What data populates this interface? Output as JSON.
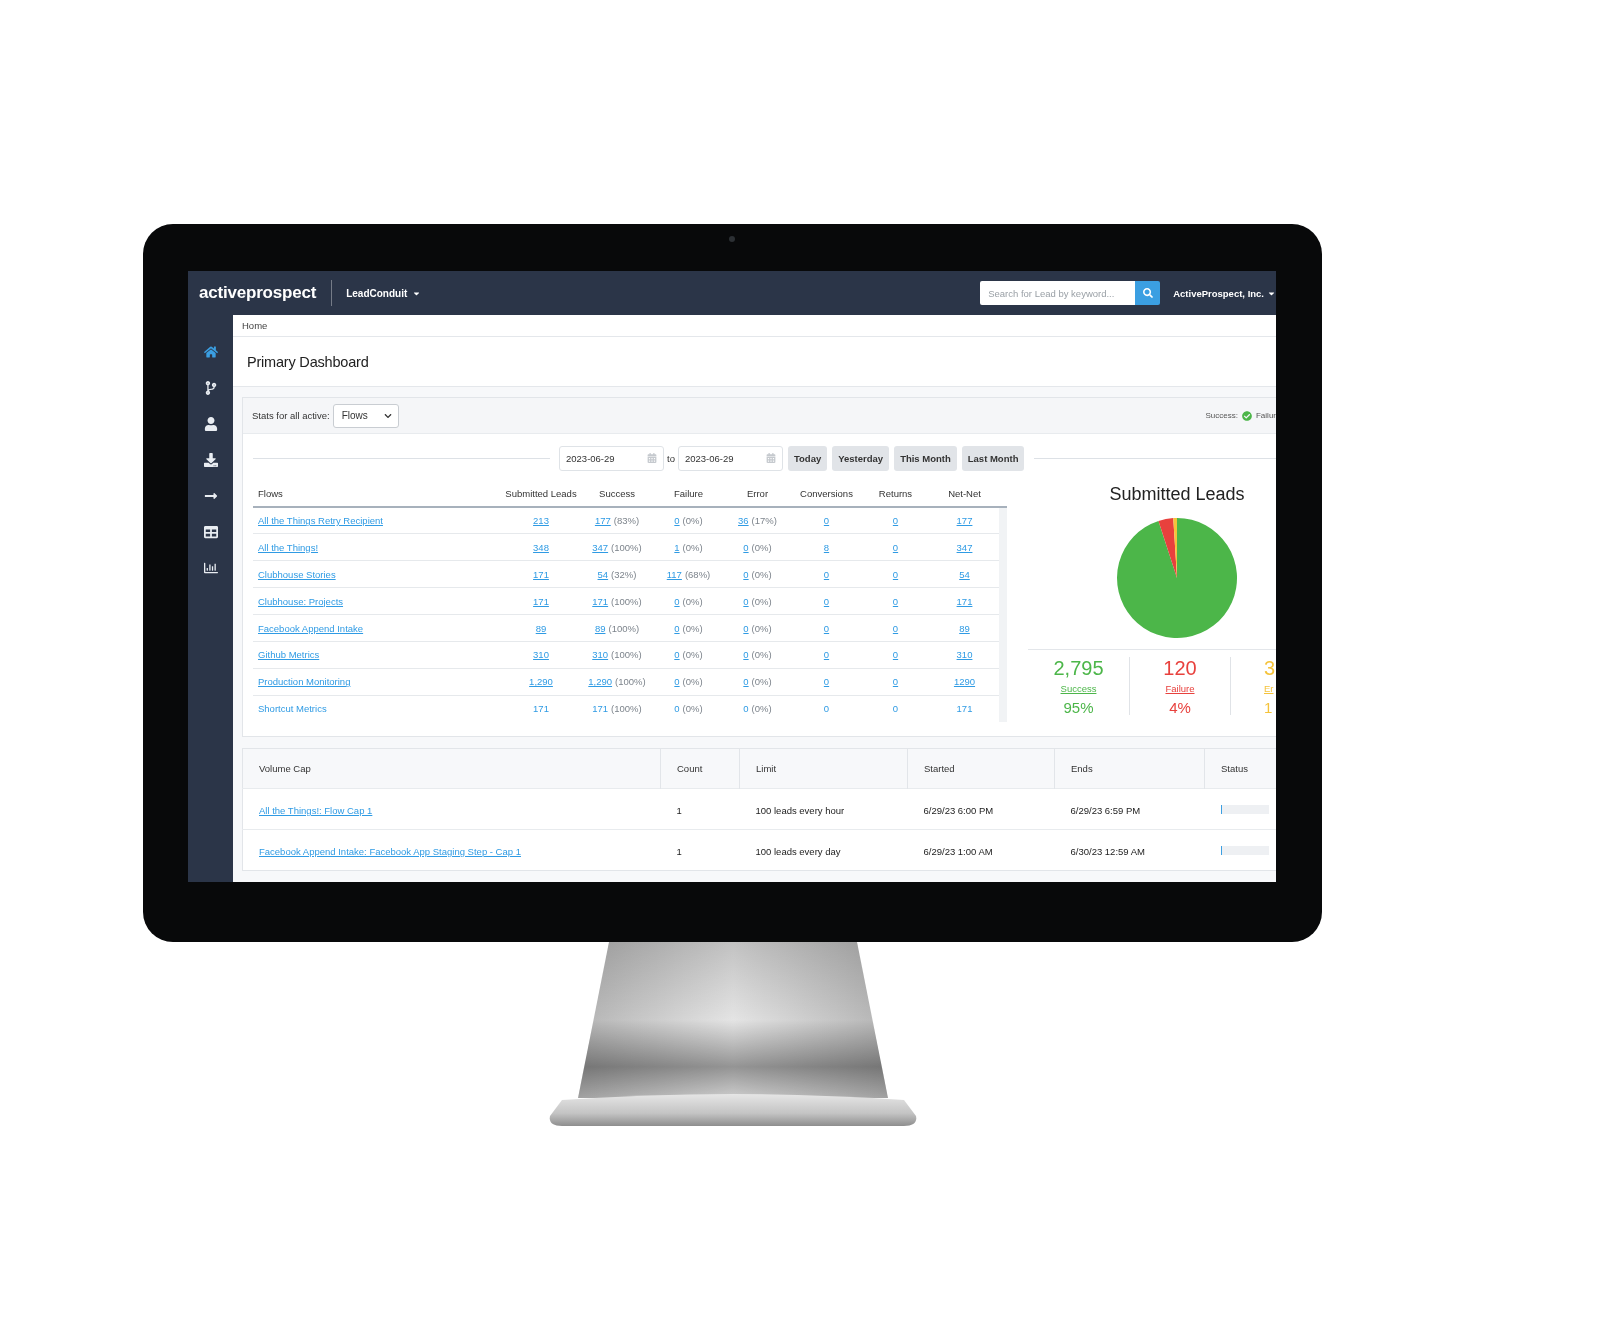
{
  "navbar": {
    "logo": "activeprospect",
    "product_menu": "LeadConduit",
    "search": {
      "placeholder": "Search for Lead by keyword..."
    },
    "account_menu": "ActiveProspect, Inc."
  },
  "sidebar": {
    "items": [
      {
        "kind": "home",
        "selected": true
      },
      {
        "kind": "flow",
        "selected": false
      },
      {
        "kind": "user",
        "selected": false
      },
      {
        "kind": "download",
        "selected": false
      },
      {
        "kind": "arrow",
        "selected": false
      },
      {
        "kind": "table",
        "selected": false
      },
      {
        "kind": "chart",
        "selected": false
      }
    ]
  },
  "breadcrumb": [
    "Home"
  ],
  "page_title": "Primary Dashboard",
  "stats_panel": {
    "filter_label": "Stats for all active:",
    "filter_select": "Flows",
    "legend": {
      "success_label": "Success:",
      "failure_label": "Failur"
    },
    "date_range": {
      "from": "2023-06-29",
      "separator": "to",
      "to": "2023-06-29"
    },
    "presets": [
      "Today",
      "Yesterday",
      "This Month",
      "Last Month"
    ],
    "flows_table": {
      "columns": [
        "Flows",
        "Submitted Leads",
        "Success",
        "Failure",
        "Error",
        "Conversions",
        "Returns",
        "Net-Net"
      ],
      "rows": [
        {
          "linked": true,
          "flow": "All the Things Retry Recipient",
          "submitted": "213",
          "success": {
            "value": "177",
            "percent": "(83%)"
          },
          "failure": {
            "value": "0",
            "percent": "(0%)"
          },
          "error": {
            "value": "36",
            "percent": "(17%)"
          },
          "conversions": "0",
          "returns": "0",
          "net_net": "177"
        },
        {
          "linked": true,
          "flow": "All the Things!",
          "submitted": "348",
          "success": {
            "value": "347",
            "percent": "(100%)"
          },
          "failure": {
            "value": "1",
            "percent": "(0%)"
          },
          "error": {
            "value": "0",
            "percent": "(0%)"
          },
          "conversions": "8",
          "returns": "0",
          "net_net": "347"
        },
        {
          "linked": true,
          "flow": "Clubhouse Stories",
          "submitted": "171",
          "success": {
            "value": "54",
            "percent": "(32%)"
          },
          "failure": {
            "value": "117",
            "percent": "(68%)"
          },
          "error": {
            "value": "0",
            "percent": "(0%)"
          },
          "conversions": "0",
          "returns": "0",
          "net_net": "54"
        },
        {
          "linked": true,
          "flow": "Clubhouse: Projects",
          "submitted": "171",
          "success": {
            "value": "171",
            "percent": "(100%)"
          },
          "failure": {
            "value": "0",
            "percent": "(0%)"
          },
          "error": {
            "value": "0",
            "percent": "(0%)"
          },
          "conversions": "0",
          "returns": "0",
          "net_net": "171"
        },
        {
          "linked": true,
          "flow": "Facebook Append Intake",
          "submitted": "89",
          "success": {
            "value": "89",
            "percent": "(100%)"
          },
          "failure": {
            "value": "0",
            "percent": "(0%)"
          },
          "error": {
            "value": "0",
            "percent": "(0%)"
          },
          "conversions": "0",
          "returns": "0",
          "net_net": "89"
        },
        {
          "linked": true,
          "flow": "Github Metrics",
          "submitted": "310",
          "success": {
            "value": "310",
            "percent": "(100%)"
          },
          "failure": {
            "value": "0",
            "percent": "(0%)"
          },
          "error": {
            "value": "0",
            "percent": "(0%)"
          },
          "conversions": "0",
          "returns": "0",
          "net_net": "310"
        },
        {
          "linked": true,
          "flow": "Production Monitoring",
          "submitted": "1,290",
          "success": {
            "value": "1,290",
            "percent": "(100%)"
          },
          "failure": {
            "value": "0",
            "percent": "(0%)"
          },
          "error": {
            "value": "0",
            "percent": "(0%)"
          },
          "conversions": "0",
          "returns": "0",
          "net_net": "1290"
        },
        {
          "linked": false,
          "flow": "Shortcut Metrics",
          "submitted": "171",
          "success": {
            "value": "171",
            "percent": "(100%)"
          },
          "failure": {
            "value": "0",
            "percent": "(0%)"
          },
          "error": {
            "value": "0",
            "percent": "(0%)"
          },
          "conversions": "0",
          "returns": "0",
          "net_net": "171"
        }
      ]
    },
    "chart": {
      "chart_data": {
        "type": "pie",
        "title": "Submitted Leads",
        "values": [
          95,
          4,
          1
        ]
      },
      "summary": [
        {
          "count": "2,795",
          "label": "Success",
          "percent": "95%",
          "color": "#4cb649"
        },
        {
          "count": "120",
          "label": "Failure",
          "percent": "4%",
          "color": "#e8413d"
        },
        {
          "count": "3",
          "label": "Er",
          "percent": "1",
          "color": "#f5c33b"
        }
      ]
    }
  },
  "volume_caps": {
    "columns": [
      "Volume Cap",
      "Count",
      "Limit",
      "Started",
      "Ends",
      "Status"
    ],
    "rows": [
      {
        "name": "All the Things!: Flow Cap 1",
        "count": "1",
        "limit": "100 leads every hour",
        "started": "6/29/23 6:00 PM",
        "ends": "6/29/23 6:59 PM",
        "level": 0.02
      },
      {
        "name": "Facebook Append Intake: Facebook App Staging Step - Cap 1",
        "count": "1",
        "limit": "100 leads every day",
        "started": "6/29/23 1:00 AM",
        "ends": "6/30/23 12:59 AM",
        "level": 0.02
      }
    ]
  }
}
